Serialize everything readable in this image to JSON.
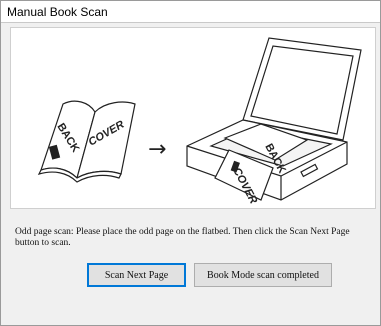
{
  "window": {
    "title": "Manual Book Scan"
  },
  "illustration": {
    "book_back_text": "BACK",
    "book_cover_text": "COVER",
    "arrow_glyph": "→"
  },
  "instruction": "Odd page scan: Please place the odd page on the flatbed. Then click the Scan Next Page button to scan.",
  "buttons": {
    "scan_next": "Scan Next Page",
    "done": "Book Mode scan completed"
  }
}
